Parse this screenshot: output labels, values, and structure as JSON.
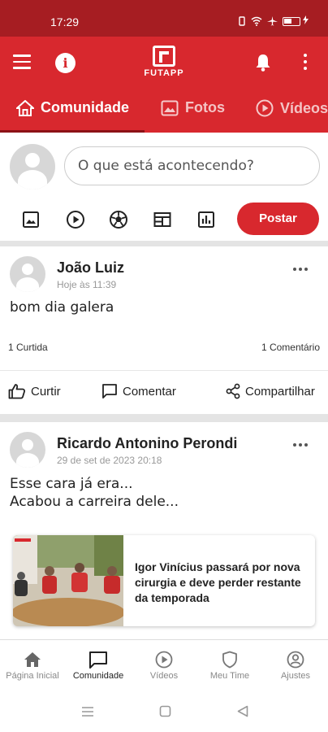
{
  "status_bar": {
    "time": "17:29"
  },
  "app_bar": {
    "logo_text": "FUTAPP"
  },
  "tabs": [
    {
      "label": "Comunidade"
    },
    {
      "label": "Fotos"
    },
    {
      "label": "Vídeos"
    }
  ],
  "composer": {
    "placeholder": "O que está acontecendo?",
    "post_label": "Postar"
  },
  "posts": [
    {
      "author": "João Luiz",
      "date": "Hoje às 11:39",
      "text": "bom dia galera",
      "likes": "1 Curtida",
      "comments": "1 Comentário",
      "actions": {
        "like": "Curtir",
        "comment": "Comentar",
        "share": "Compartilhar"
      }
    },
    {
      "author": "Ricardo Antonino Perondi",
      "date": "29 de set de 2023 20:18",
      "text_line1": "Esse cara já era...",
      "text_line2": "Acabou a carreira dele...",
      "link_title": "Igor Vinícius passará por nova cirurgia e deve perder restante da temporada"
    }
  ],
  "bottom_nav": [
    {
      "label": "Página Inicial",
      "icon": "home-icon"
    },
    {
      "label": "Comunidade",
      "icon": "chat-icon"
    },
    {
      "label": "Vídeos",
      "icon": "play-icon"
    },
    {
      "label": "Meu Time",
      "icon": "shield-icon"
    },
    {
      "label": "Ajustes",
      "icon": "profile-icon"
    }
  ],
  "colors": {
    "primary": "#d8282e",
    "status_bar": "#a61d22"
  }
}
